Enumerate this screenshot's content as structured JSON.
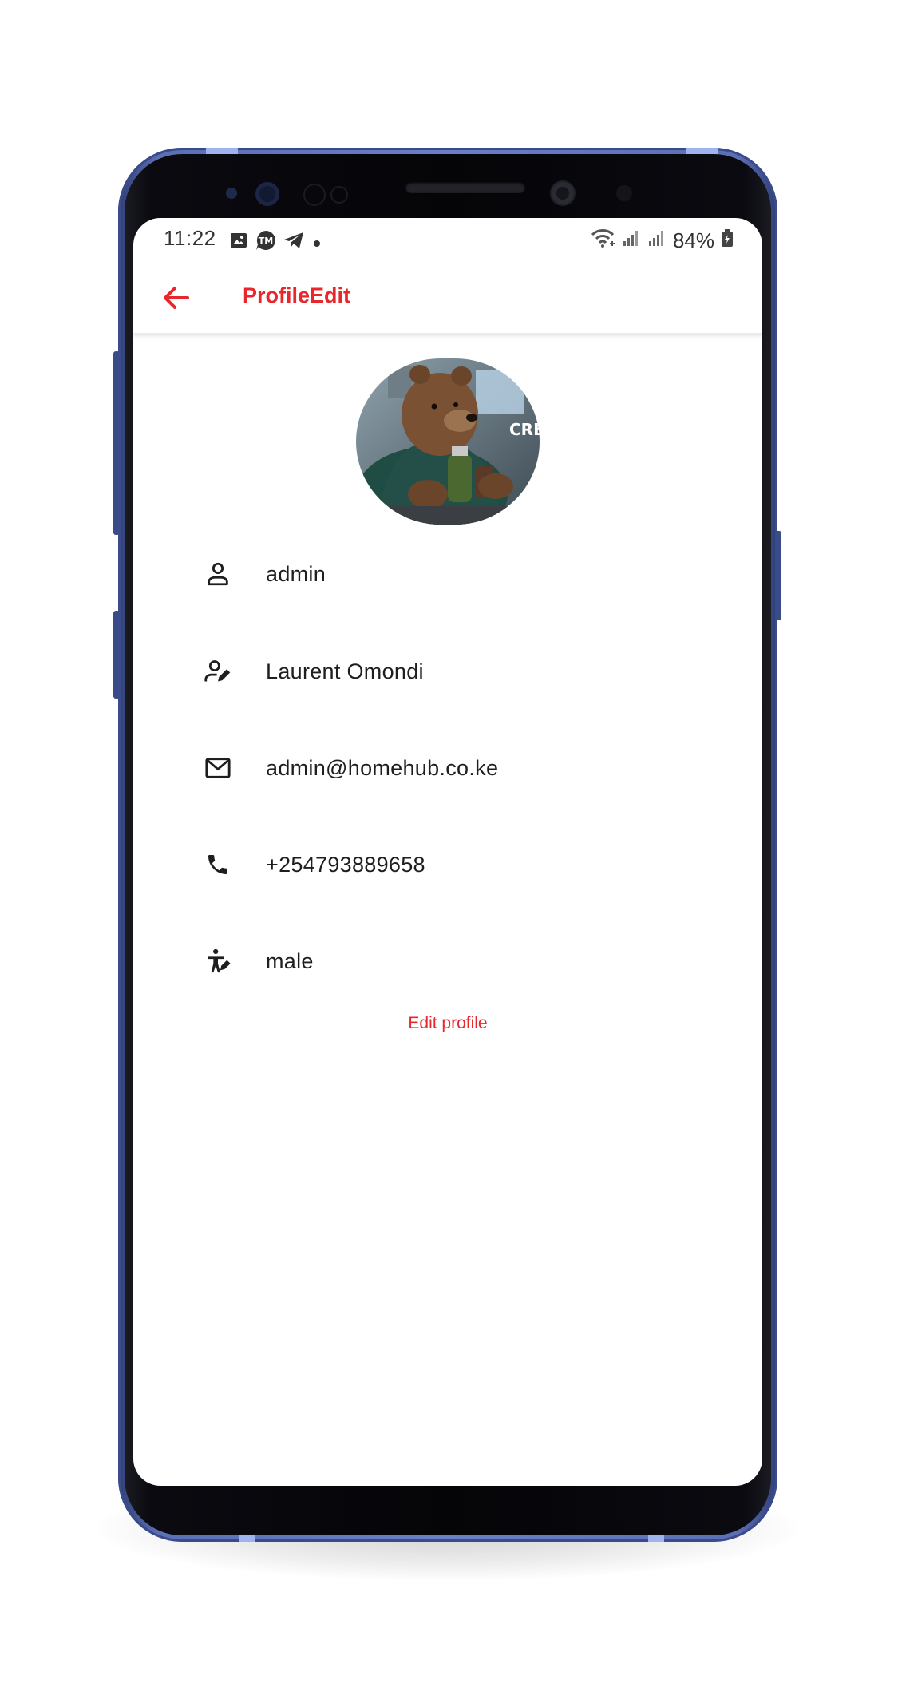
{
  "status_bar": {
    "time": "11:22",
    "left_icons": [
      "image-icon",
      "tm-icon",
      "telegram-icon",
      "dot-icon"
    ],
    "right_icons": [
      "wifi-icon",
      "signal-icon",
      "signal-icon",
      "battery-icon"
    ],
    "battery_percent": "84%"
  },
  "app_bar": {
    "back_icon": "arrow-back-icon",
    "title": "ProfileEdit",
    "accent_color": "#e8262b"
  },
  "profile": {
    "avatar_icon": "avatar-image",
    "avatar_text": "CREA",
    "fields": [
      {
        "icon": "person-icon",
        "value": "admin"
      },
      {
        "icon": "person-edit-icon",
        "value": "Laurent Omondi"
      },
      {
        "icon": "mail-icon",
        "value": "admin@homehub.co.ke"
      },
      {
        "icon": "phone-icon",
        "value": "+254793889658"
      },
      {
        "icon": "gender-icon",
        "value": "male"
      }
    ],
    "edit_label": "Edit profile"
  }
}
